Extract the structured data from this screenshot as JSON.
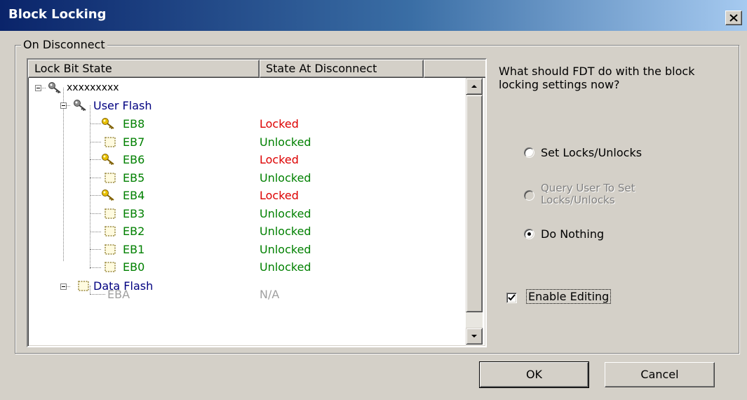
{
  "window": {
    "title": "Block Locking"
  },
  "group": {
    "label": "On Disconnect"
  },
  "tree": {
    "columns": [
      "Lock Bit State",
      "State At Disconnect"
    ],
    "rows": [
      {
        "label": "xxxxxxxxx",
        "state": "",
        "icon": "key-gray-icon"
      },
      {
        "label": "User Flash",
        "state": "",
        "icon": "key-gray-icon"
      },
      {
        "label": "EB8",
        "state": "Locked",
        "icon": "key-gold-icon"
      },
      {
        "label": "EB7",
        "state": "Unlocked",
        "icon": "unlocked-box-icon"
      },
      {
        "label": "EB6",
        "state": "Locked",
        "icon": "key-gold-icon"
      },
      {
        "label": "EB5",
        "state": "Unlocked",
        "icon": "unlocked-box-icon"
      },
      {
        "label": "EB4",
        "state": "Locked",
        "icon": "key-gold-icon"
      },
      {
        "label": "EB3",
        "state": "Unlocked",
        "icon": "unlocked-box-icon"
      },
      {
        "label": "EB2",
        "state": "Unlocked",
        "icon": "unlocked-box-icon"
      },
      {
        "label": "EB1",
        "state": "Unlocked",
        "icon": "unlocked-box-icon"
      },
      {
        "label": "EB0",
        "state": "Unlocked",
        "icon": "unlocked-box-icon"
      },
      {
        "label": "Data Flash",
        "state": "",
        "icon": "unlocked-box-icon"
      },
      {
        "label": "EBA",
        "state": "N/A",
        "icon": ""
      }
    ]
  },
  "question": "What should FDT do with the block locking settings now?",
  "options": {
    "set": "Set Locks/Unlocks",
    "query_line1": "Query User To Set",
    "query_line2": "Locks/Unlocks",
    "nothing": "Do Nothing",
    "selected": "Do Nothing"
  },
  "enable_editing": {
    "label": "Enable Editing",
    "checked": true
  },
  "buttons": {
    "ok": "OK",
    "cancel": "Cancel"
  },
  "colors": {
    "locked": "#dd0000",
    "unlocked": "#008000",
    "group_node": "#000080",
    "disabled": "#a0a0a0",
    "key_gold": "#e8c000",
    "key_gray": "#8c8c8c"
  }
}
